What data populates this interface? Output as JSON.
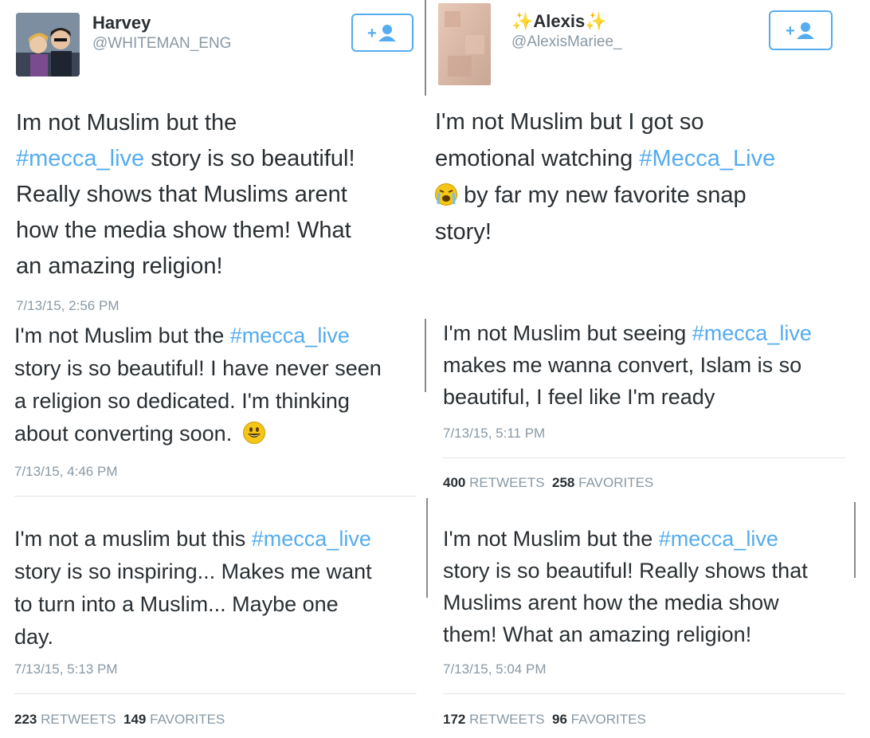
{
  "colors": {
    "hashtag": "#55acee",
    "follow_border": "#55acee",
    "meta": "#8899a6"
  },
  "left": {
    "profile": {
      "name": "Harvey",
      "handle": "@WHITEMAN_ENG"
    },
    "tweet1": {
      "lines": [
        [
          "Im not Muslim but the"
        ],
        [
          "#mecca_live",
          " story is so beautiful!"
        ],
        [
          "Really shows that Muslims arent"
        ],
        [
          "how the media show them! What"
        ],
        [
          "an amazing religion!"
        ]
      ],
      "timestamp": "7/13/15, 2:56 PM"
    },
    "tweet2": {
      "line1_pre": "I'm not Muslim but the ",
      "line1_tag": "#mecca_live",
      "line2": "story is so beautiful! I have never seen",
      "line3": "a religion so dedicated. I'm thinking",
      "line4": "about converting soon.",
      "emoji": "smiley-emoji-icon",
      "timestamp": "7/13/15, 4:46 PM"
    },
    "tweet3": {
      "line1_pre": "I'm not a muslim but this ",
      "line1_tag": "#mecca_live",
      "line2": "story is so inspiring... Makes me want",
      "line3": "to turn into a Muslim... Maybe one",
      "line4": "day.",
      "timestamp": "7/13/15, 5:13 PM",
      "retweets": "223",
      "retweets_label": "RETWEETS",
      "favorites": "149",
      "favorites_label": "FAVORITES"
    }
  },
  "right": {
    "profile": {
      "name_sparkle_left": "✨",
      "name": "Alexis",
      "name_sparkle_right": "✨",
      "handle": "@AlexisMariee_"
    },
    "tweet1": {
      "line1": "I'm not Muslim but I got so",
      "line2_pre": "emotional watching ",
      "line2_tag": "#Mecca_Live",
      "line3": " by far my new favorite snap",
      "line4": "story!",
      "emoji": "crying-emoji-icon"
    },
    "tweet2": {
      "line1_pre": "I'm not Muslim but seeing ",
      "line1_tag": "#mecca_live",
      "line2": "makes me wanna convert, Islam is so",
      "line3": "beautiful, I feel like I'm ready",
      "timestamp": "7/13/15, 5:11 PM",
      "retweets": "400",
      "retweets_label": "RETWEETS",
      "favorites": "258",
      "favorites_label": "FAVORITES"
    },
    "tweet3": {
      "line1_pre": "I'm not Muslim but the ",
      "line1_tag": "#mecca_live",
      "line2": "story is so beautiful! Really shows that",
      "line3": "Muslims arent how the media show",
      "line4": "them! What an amazing religion!",
      "timestamp": "7/13/15, 5:04 PM",
      "retweets": "172",
      "retweets_label": "RETWEETS",
      "favorites": "96",
      "favorites_label": "FAVORITES"
    }
  }
}
